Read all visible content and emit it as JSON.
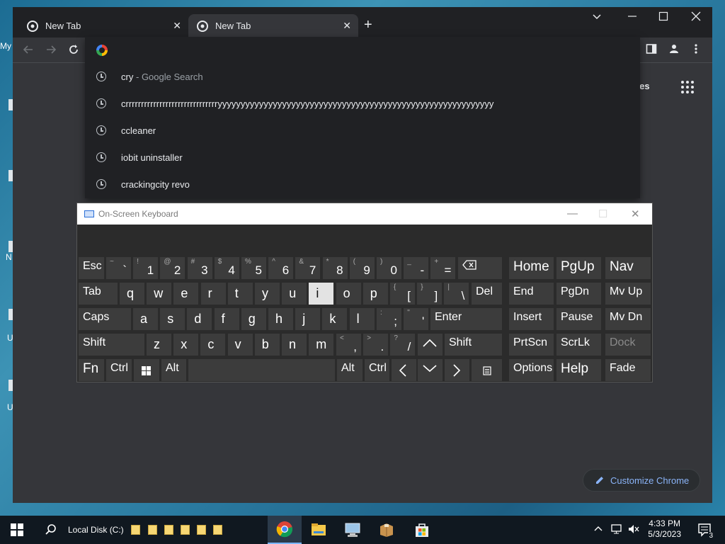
{
  "desktop": {
    "edge_labels": [
      "My",
      "N",
      "U",
      "U"
    ]
  },
  "chrome": {
    "tabs": [
      {
        "label": "New Tab",
        "active": false
      },
      {
        "label": "New Tab",
        "active": true
      }
    ],
    "omnibox": {
      "value": "",
      "suggestions": [
        {
          "text": "cry",
          "suffix": "Google Search",
          "separator": "-"
        },
        {
          "text": "crrrrrrrrrrrrrrrrrrrrrrrrrrrrrryyyyyyyyyyyyyyyyyyyyyyyyyyyyyyyyyyyyyyyyyyyyyyyyyyyyyyyyyyyy"
        },
        {
          "text": "ccleaner"
        },
        {
          "text": "iobit uninstaller"
        },
        {
          "text": "crackingcity revo"
        }
      ]
    },
    "images_link": "nages",
    "customize_button": "Customize Chrome"
  },
  "osk": {
    "title": "On-Screen Keyboard",
    "keys": {
      "esc": "Esc",
      "tab": "Tab",
      "caps": "Caps",
      "shift": "Shift",
      "fn": "Fn",
      "ctrl": "Ctrl",
      "alt": "Alt",
      "enter": "Enter",
      "del": "Del",
      "home": "Home",
      "pgup": "PgUp",
      "nav": "Nav",
      "end": "End",
      "pgdn": "PgDn",
      "mvup": "Mv Up",
      "insert": "Insert",
      "pause": "Pause",
      "mvdn": "Mv Dn",
      "prtscn": "PrtScn",
      "scrlk": "ScrLk",
      "dock": "Dock",
      "options": "Options",
      "help": "Help",
      "fade": "Fade",
      "row1_letters": [
        "q",
        "w",
        "e",
        "r",
        "t",
        "y",
        "u",
        "i",
        "o",
        "p"
      ],
      "row2_letters": [
        "a",
        "s",
        "d",
        "f",
        "g",
        "h",
        "j",
        "k",
        "l"
      ],
      "row3_letters": [
        "z",
        "x",
        "c",
        "v",
        "b",
        "n",
        "m"
      ],
      "numbers": [
        {
          "shift": "~",
          "main": "`"
        },
        {
          "shift": "!",
          "main": "1"
        },
        {
          "shift": "@",
          "main": "2"
        },
        {
          "shift": "#",
          "main": "3"
        },
        {
          "shift": "$",
          "main": "4"
        },
        {
          "shift": "%",
          "main": "5"
        },
        {
          "shift": "^",
          "main": "6"
        },
        {
          "shift": "&",
          "main": "7"
        },
        {
          "shift": "*",
          "main": "8"
        },
        {
          "shift": "(",
          "main": "9"
        },
        {
          "shift": ")",
          "main": "0"
        },
        {
          "shift": "_",
          "main": "-"
        },
        {
          "shift": "+",
          "main": "="
        }
      ],
      "brackets": [
        {
          "shift": "{",
          "main": "["
        },
        {
          "shift": "}",
          "main": "]"
        },
        {
          "shift": "|",
          "main": "\\"
        }
      ],
      "semi": [
        {
          "shift": ":",
          "main": ";"
        },
        {
          "shift": "\"",
          "main": "'"
        }
      ],
      "punct": [
        {
          "shift": "<",
          "main": ","
        },
        {
          "shift": ">",
          "main": "."
        },
        {
          "shift": "?",
          "main": "/"
        }
      ]
    },
    "highlighted_key": "i"
  },
  "taskbar": {
    "search_label": "Local Disk (C:)",
    "time": "4:33 PM",
    "date": "5/3/2023",
    "notification_count": "3"
  },
  "colors": {
    "chrome_bg": "#35363a",
    "tabstrip_bg": "#202124",
    "accent_link": "#8ab4f8",
    "osk_key": "#3c3c3c"
  }
}
